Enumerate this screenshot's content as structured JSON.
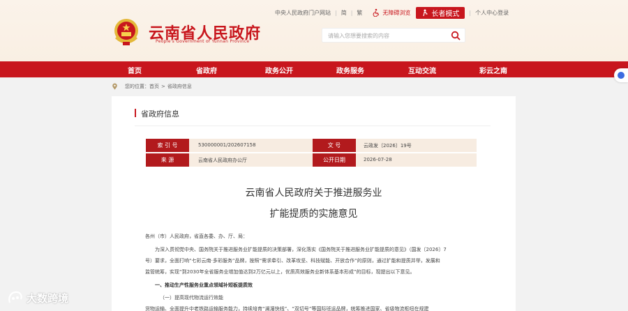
{
  "header": {
    "site_title": "云南省人民政府",
    "site_subtitle": "People's Government of Yunnan Province",
    "toplinks": {
      "portal": "中央人民政府门户网站",
      "simplified": "简",
      "traditional": "繁",
      "accessibility": "无障碍浏览",
      "elder_mode": "长者模式",
      "user_center": "个人中心登录"
    },
    "search": {
      "placeholder": "请输入您想要搜索的内容"
    }
  },
  "nav": {
    "items": [
      "首页",
      "省政府",
      "政务公开",
      "政务服务",
      "互动交流",
      "彩云之南"
    ]
  },
  "breadcrumb": {
    "prefix": "您的位置：",
    "home": "首页",
    "current": "省政府信息"
  },
  "section": {
    "title": "省政府信息"
  },
  "meta": {
    "index_label": "索 引 号",
    "index_value": "530000001/202607158",
    "docno_label": "文    号",
    "docno_value": "云政发〔2026〕19号",
    "source_label": "来    源",
    "source_value": "云南省人民政府办公厅",
    "date_label": "公开日期",
    "date_value": "2026-07-28"
  },
  "document": {
    "title_line1": "云南省人民政府关于推进服务业",
    "title_line2": "扩能提质的实施意见",
    "salutation": "各州（市）人民政府，省直各委、办、厅、局：",
    "p1_line1": "为深入贯彻党中央、国务院关于推进服务业扩能提质的决策部署，深化落实《国务院关于推进服务业扩能提质的意见》（国发〔2026〕7",
    "p1_line2": "号）要求，全面打响“七彩云南·多彩服务”品牌，按照“需求牵引、改革攻坚、科技赋能、开放合作”的原则，通过扩能和提质并举，发展和",
    "p1_line3": "监管统筹，实现“到2030年全省服务业增加值达到2万亿元以上，优质高效服务业新体系基本形成”的目标，现提出以下意见。",
    "heading1": "一、推动生产性服务业重点领域补短板提质效",
    "sub1": "（一）提高现代物流运行效能",
    "p2_line1": "货物运输、全面提升中老铁路运输服务能力，持续培育“澜湄快线”、“双切号”等国际班运品牌，统筹推进国家、省级物流枢纽在规建"
  },
  "watermark": "大数跨境"
}
